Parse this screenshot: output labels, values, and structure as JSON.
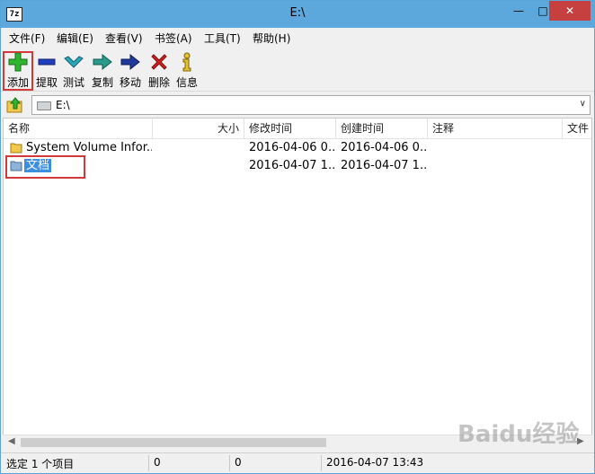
{
  "window": {
    "title": "E:\\",
    "icon_text": "7z"
  },
  "menu": [
    "文件(F)",
    "编辑(E)",
    "查看(V)",
    "书签(A)",
    "工具(T)",
    "帮助(H)"
  ],
  "toolbar": {
    "add": "添加",
    "extract": "提取",
    "test": "测试",
    "copy": "复制",
    "move": "移动",
    "delete": "删除",
    "info": "信息"
  },
  "address": {
    "path": "E:\\"
  },
  "columns": {
    "name": "名称",
    "size": "大小",
    "modified": "修改时间",
    "created": "创建时间",
    "comment": "注释",
    "files": "文件"
  },
  "rows": [
    {
      "name": "System Volume Infor...",
      "size": "",
      "modified": "2016-04-06 0...",
      "created": "2016-04-06 0..."
    },
    {
      "name": "文档",
      "size": "",
      "modified": "2016-04-07 1...",
      "created": "2016-04-07 1..."
    }
  ],
  "status": {
    "selection": "选定 1 个项目",
    "size1": "0",
    "size2": "0",
    "datetime": "2016-04-07 13:43"
  },
  "watermark": "Baidu经验",
  "colors": {
    "titlebar": "#5ca8dc",
    "close_button": "#c74040",
    "selection": "#3b8fe0",
    "highlight_box": "#d23a3a",
    "add_icon": "#2fb52f",
    "delete_icon": "#d62020",
    "folder": "#f2c94c"
  }
}
